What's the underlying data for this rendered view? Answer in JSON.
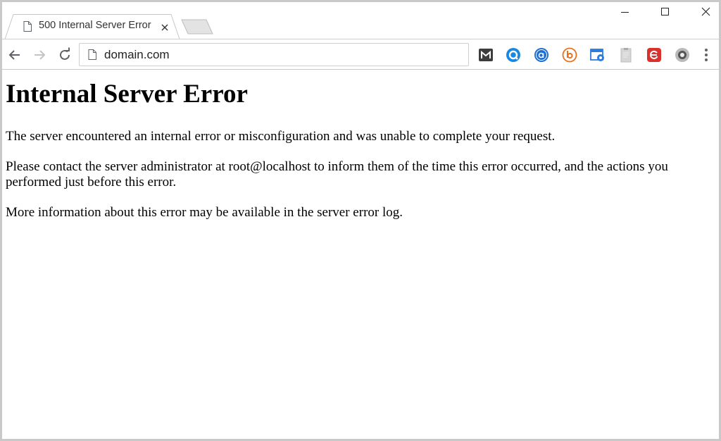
{
  "tab": {
    "title": "500 Internal Server Error"
  },
  "omnibox": {
    "url": "domain.com"
  },
  "extensions": [
    {
      "name": "m-extension-icon",
      "color": "#3d3d3d",
      "letter": "M"
    },
    {
      "name": "q-extension-icon",
      "color": "#1a88e0",
      "letter": "Q"
    },
    {
      "name": "a-extension-icon",
      "color": "#1e6fd0",
      "letter": "a"
    },
    {
      "name": "b-extension-icon",
      "color": "#e8711d",
      "letter": "b"
    },
    {
      "name": "camera-extension-icon",
      "color": "#2c7de0"
    },
    {
      "name": "clipboard-extension-icon",
      "color": "#c8c8c8"
    },
    {
      "name": "e-extension-icon",
      "color": "#d9322c",
      "letter": "e"
    },
    {
      "name": "eye-extension-icon",
      "color": "#808080"
    }
  ],
  "page": {
    "heading": "Internal Server Error",
    "paragraphs": [
      "The server encountered an internal error or misconfiguration and was unable to complete your request.",
      "Please contact the server administrator at root@localhost to inform them of the time this error occurred, and the actions you performed just before this error.",
      "More information about this error may be available in the server error log."
    ]
  }
}
